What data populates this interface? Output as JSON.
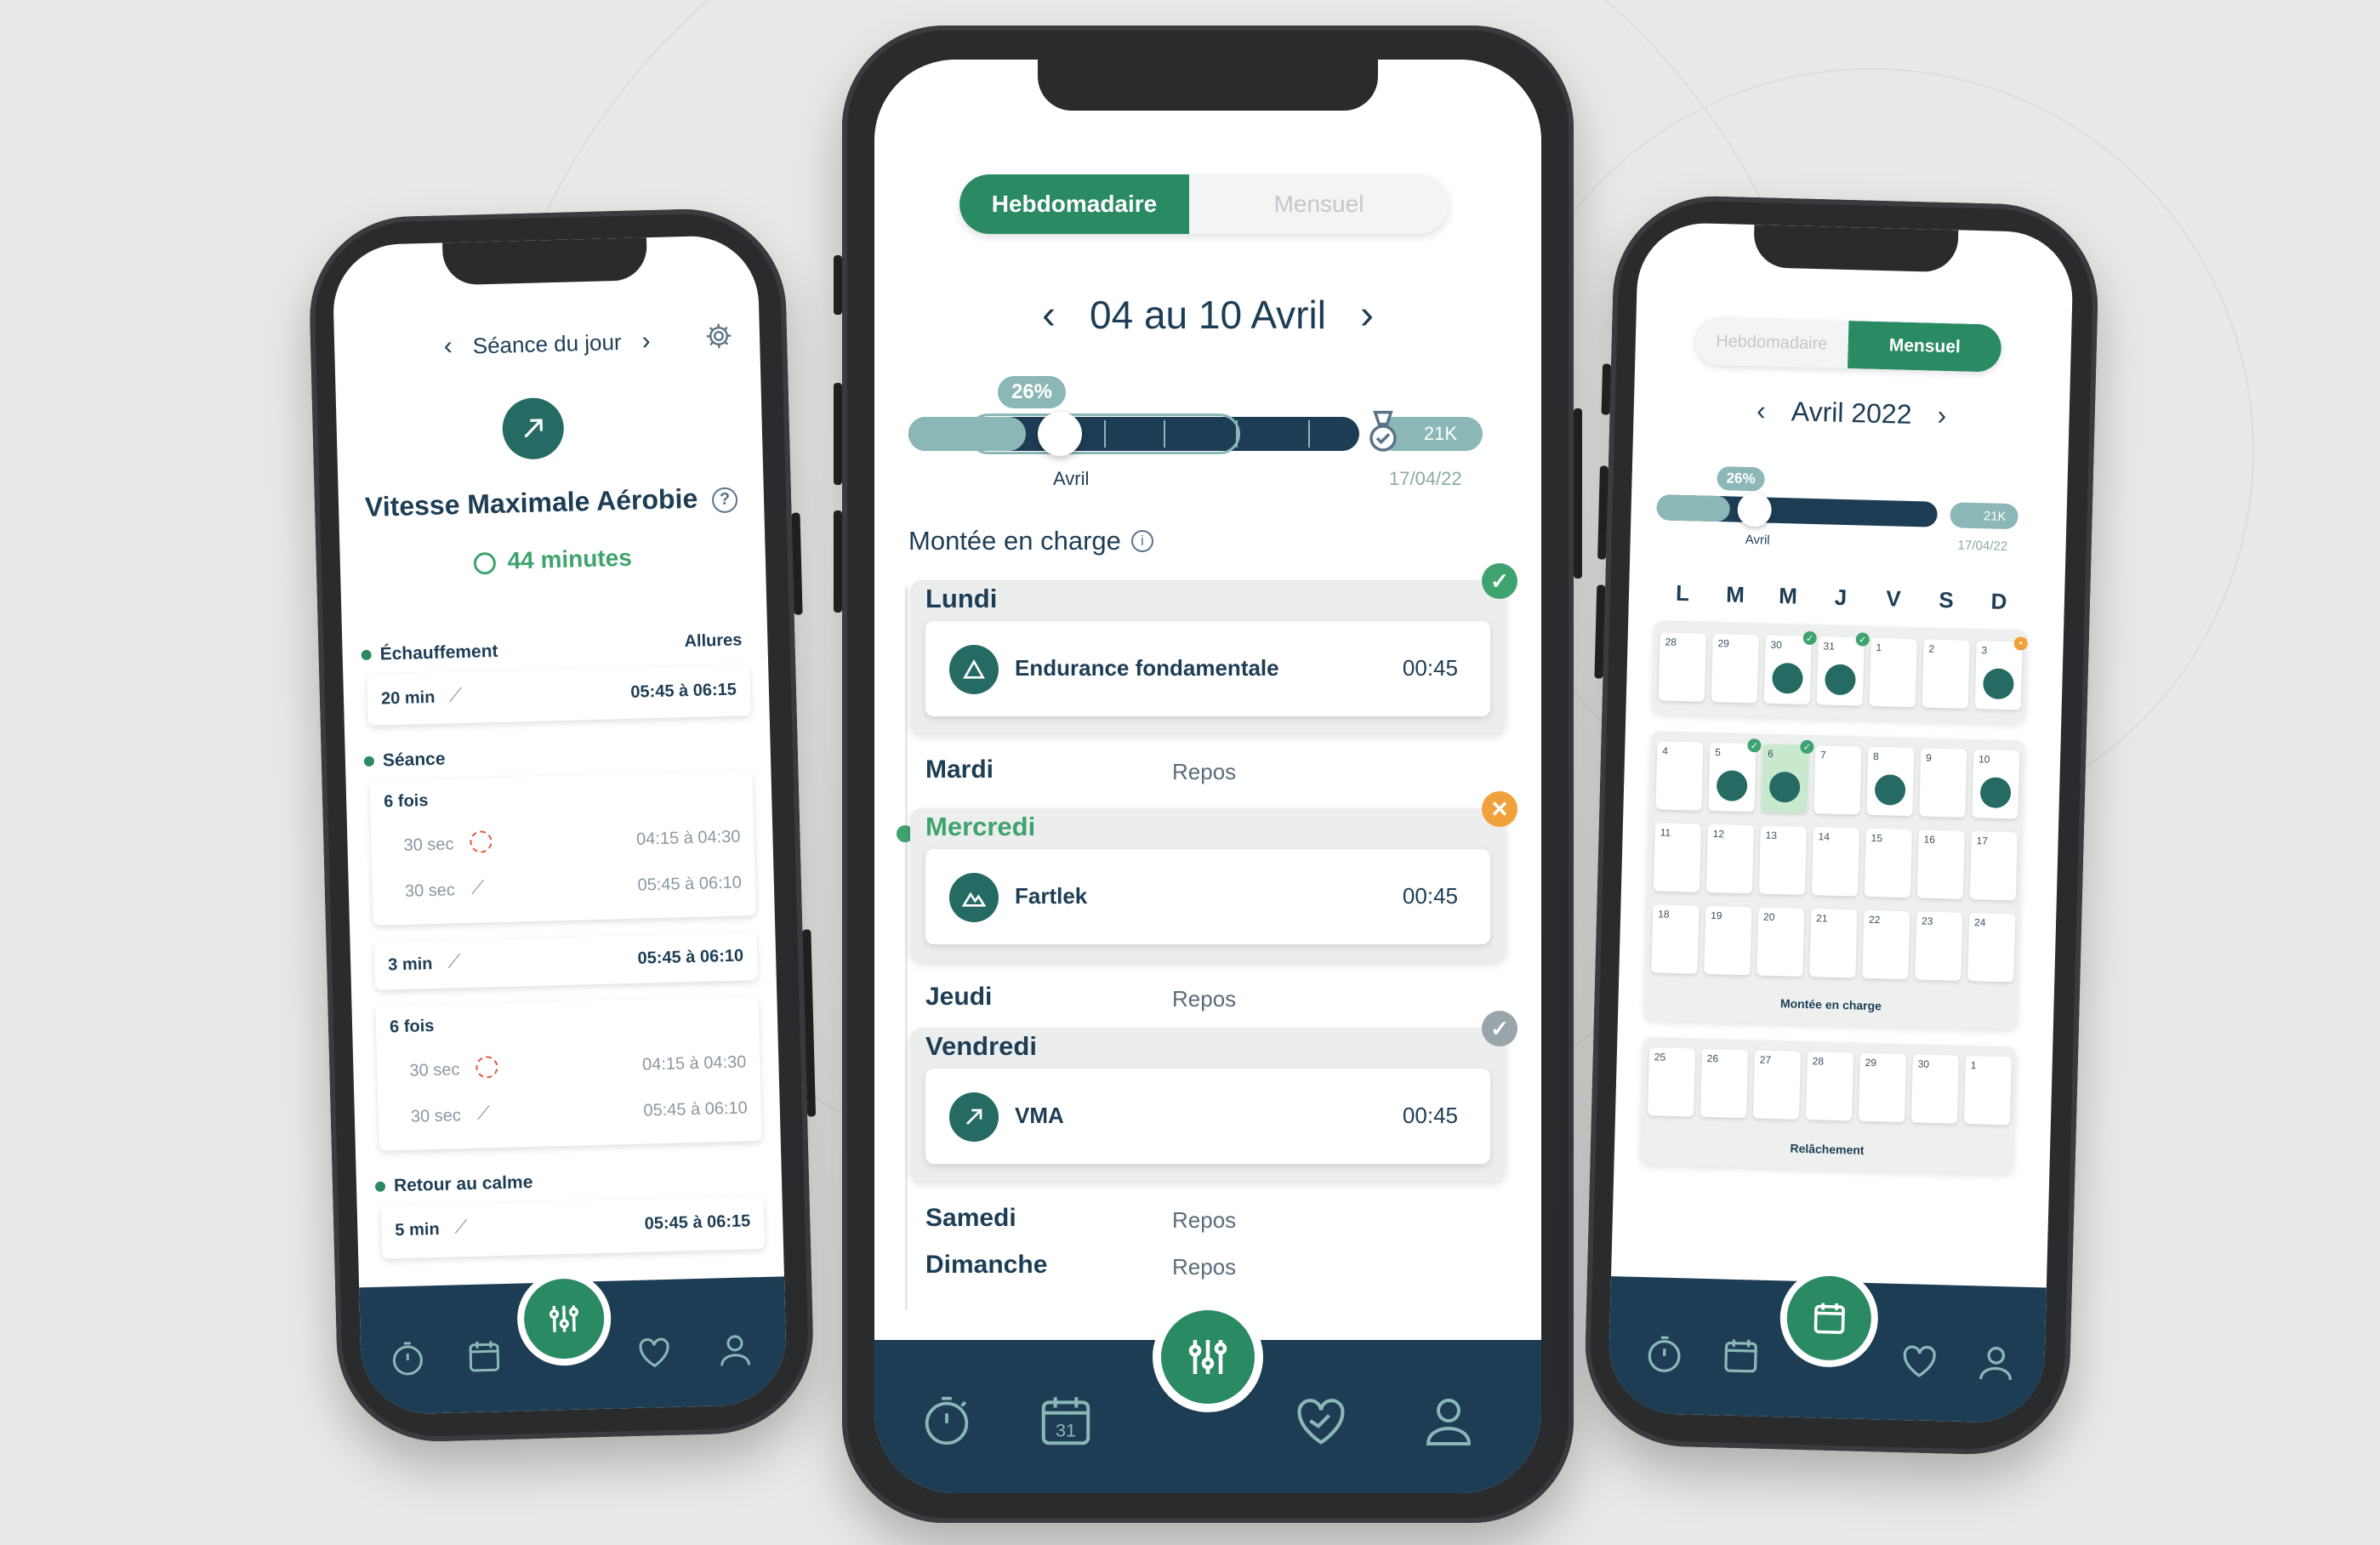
{
  "colors": {
    "brand_green": "#2a8a63",
    "navy": "#1d3d55",
    "teal": "#8cb7b7",
    "done": "#3fa36f",
    "missed": "#f0a13b",
    "pending": "#9aa4ab"
  },
  "tabbar": {
    "items": [
      {
        "name": "stopwatch-icon"
      },
      {
        "name": "calendar-icon",
        "label": "31"
      },
      {
        "name": "sliders-icon"
      },
      {
        "name": "heart-handshake-icon"
      },
      {
        "name": "user-icon"
      }
    ]
  },
  "center": {
    "toggle": {
      "active": "Hebdomadaire",
      "inactive": "Mensuel"
    },
    "week_title": "04 au 10 Avril",
    "progress": {
      "percent_label": "26%",
      "percent": 26,
      "goal_label": "21K",
      "month_label": "Avril",
      "goal_date": "17/04/22"
    },
    "phase_title": "Montée en charge",
    "days": [
      {
        "day": "Lundi",
        "session": "Endurance fondamentale",
        "time": "00:45",
        "status": "done",
        "icon": "triangle-icon"
      },
      {
        "day": "Mardi",
        "rest": "Repos"
      },
      {
        "day": "Mercredi",
        "session": "Fartlek",
        "time": "00:45",
        "status": "missed",
        "icon": "mountain-icon",
        "today": true
      },
      {
        "day": "Jeudi",
        "rest": "Repos"
      },
      {
        "day": "Vendredi",
        "session": "VMA",
        "time": "00:45",
        "status": "pending",
        "icon": "arrow-up-right-icon"
      },
      {
        "day": "Samedi",
        "rest": "Repos"
      },
      {
        "day": "Dimanche",
        "rest": "Repos"
      }
    ]
  },
  "left": {
    "header": "Séance du jour",
    "title": "Vitesse Maximale Aérobie",
    "duration": "44 minutes",
    "allures_label": "Allures",
    "sections": {
      "warmup": "Échauffement",
      "session": "Séance",
      "cooldown": "Retour au calme"
    },
    "warmup_row": {
      "label": "20 min",
      "pace": "05:45 à 06:15"
    },
    "block1": {
      "repeat": "6 fois",
      "fast": {
        "label": "30 sec",
        "pace": "04:15 à 04:30"
      },
      "slow": {
        "label": "30 sec",
        "pace": "05:45 à 06:10"
      }
    },
    "mid_row": {
      "label": "3 min",
      "pace": "05:45 à 06:10"
    },
    "block2": {
      "repeat": "6 fois",
      "fast": {
        "label": "30 sec",
        "pace": "04:15 à 04:30"
      },
      "slow": {
        "label": "30 sec",
        "pace": "05:45 à 06:10"
      }
    },
    "cooldown_row": {
      "label": "5 min",
      "pace": "05:45 à 06:15"
    }
  },
  "right": {
    "toggle": {
      "inactive": "Hebdomadaire",
      "active": "Mensuel"
    },
    "month_title": "Avril 2022",
    "progress": {
      "percent_label": "26%",
      "goal_label": "21K",
      "month_label": "Avril",
      "goal_date": "17/04/22"
    },
    "weekdays": [
      "L",
      "M",
      "M",
      "J",
      "V",
      "S",
      "D"
    ],
    "weeks": [
      [
        "28",
        "29",
        "30",
        "31",
        "1",
        "2",
        "3"
      ],
      [
        "4",
        "5",
        "6",
        "7",
        "8",
        "9",
        "10"
      ],
      [
        "11",
        "12",
        "13",
        "14",
        "15",
        "16",
        "17"
      ],
      [
        "18",
        "19",
        "20",
        "21",
        "22",
        "23",
        "24"
      ],
      [
        "25",
        "26",
        "27",
        "28",
        "29",
        "30",
        "1"
      ]
    ],
    "phase_load": "Montée en charge",
    "phase_release": "Relâchement"
  }
}
